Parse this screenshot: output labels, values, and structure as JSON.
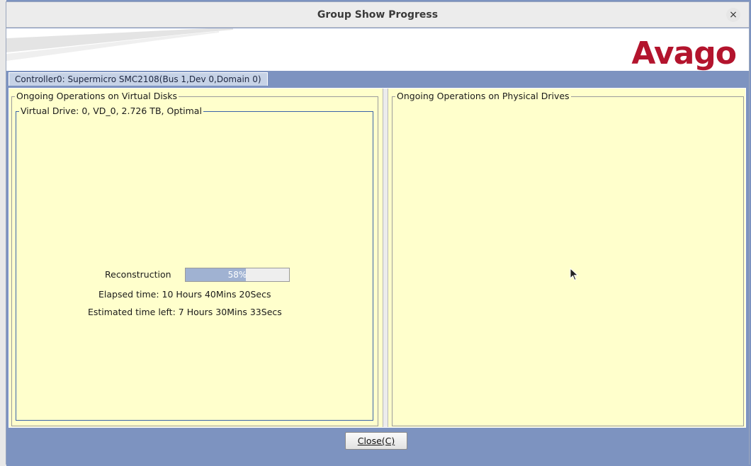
{
  "window": {
    "title": "Group Show Progress",
    "close_icon": "×"
  },
  "banner": {
    "logo_text": "Avago"
  },
  "tab": {
    "label": "Controller0: Supermicro SMC2108(Bus 1,Dev 0,Domain 0)"
  },
  "virtual_disks": {
    "group_title": "Ongoing Operations on Virtual Disks",
    "drive": {
      "title": "Virtual Drive: 0, VD_0, 2.726 TB, Optimal",
      "operation_label": "Reconstruction",
      "progress_percent": 58,
      "progress_text": "58%",
      "elapsed": "Elapsed time: 10 Hours 40Mins 20Secs",
      "remaining": "Estimated time left: 7 Hours 30Mins 33Secs"
    }
  },
  "physical_drives": {
    "group_title": "Ongoing Operations on Physical Drives"
  },
  "buttons": {
    "close_label": "Close(C)"
  },
  "colors": {
    "accent": "#7d93c0",
    "panel_bg": "#ffffcc",
    "logo": "#b3142d",
    "progress_fill": "#a0b2d2"
  }
}
